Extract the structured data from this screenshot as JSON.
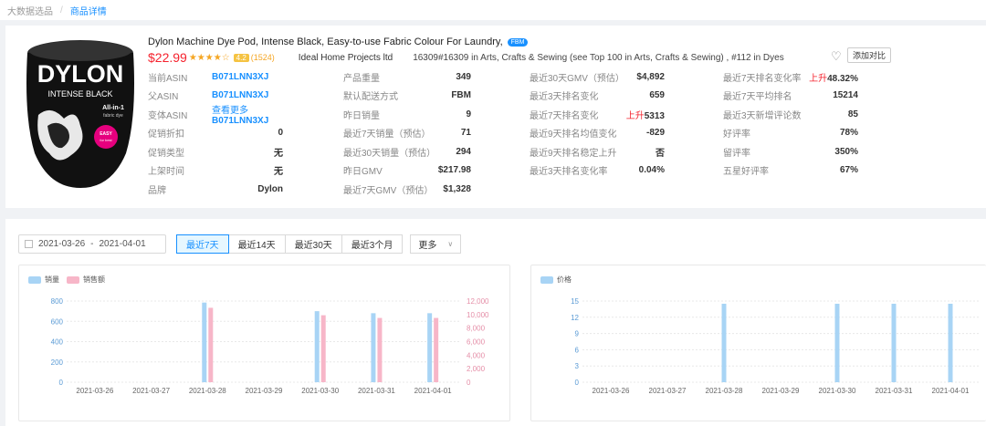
{
  "breadcrumb": {
    "root": "大数据选品",
    "separator": "/",
    "current": "商品详情"
  },
  "product": {
    "title": "Dylon Machine Dye Pod, Intense Black, Easy-to-use Fabric Colour For Laundry,",
    "badge": "FBM",
    "price": "$22.99",
    "stars": "★★★★☆",
    "rating": "4.2",
    "reviews": "(1524)",
    "seller": "Ideal Home Projects ltd",
    "rank_text": "16309#16309 in Arts, Crafts & Sewing (see Top 100 in Arts, Crafts & Sewing) , #112 in Dyes",
    "add_compare": "添加对比",
    "image": {
      "brand": "DYLON",
      "line1": "INTENSE BLACK",
      "line2": "All-in-1",
      "line3": "fabric dye",
      "badge1": "EASY",
      "badge2": "for best"
    },
    "colors": {
      "accent": "#1890ff",
      "red": "#f5222d",
      "star": "#f5a623"
    }
  },
  "info": {
    "col1": [
      {
        "label": "当前ASIN",
        "value": "B071LNN3XJ"
      },
      {
        "label": "父ASIN",
        "value": "B071LNN3XJ"
      },
      {
        "label": "变体ASIN",
        "link": "查看更多",
        "value": "B071LNN3XJ"
      },
      {
        "label": "促销折扣",
        "value": "0"
      },
      {
        "label": "促销类型",
        "value": "无"
      },
      {
        "label": "上架时间",
        "value": "无"
      },
      {
        "label": "品牌",
        "value": "Dylon"
      }
    ],
    "col2": [
      {
        "label": "产品重量",
        "value": "349"
      },
      {
        "label": "默认配送方式",
        "value": "FBM"
      },
      {
        "label": "昨日销量",
        "value": "9"
      },
      {
        "label": "最近7天销量（预估）",
        "value": "71"
      },
      {
        "label": "最近30天销量（预估）",
        "value": "294"
      },
      {
        "label": "昨日GMV",
        "value": "$217.98"
      },
      {
        "label": "最近7天GMV（预估）",
        "value": "$1,328"
      }
    ],
    "col3": [
      {
        "label": "最近30天GMV（预估）",
        "value": "$4,892"
      },
      {
        "label": "最近3天排名变化",
        "value": "659"
      },
      {
        "label": "最近7天排名变化",
        "prefix": "上升",
        "value": "5313"
      },
      {
        "label": "最近9天排名均值变化",
        "value": "-829"
      },
      {
        "label": "最近9天排名稳定上升",
        "value": "否"
      },
      {
        "label": "最近3天排名变化率",
        "value": "0.04%"
      }
    ],
    "col4": [
      {
        "label": "最近7天排名变化率",
        "prefix": "上升",
        "value": "48.32%"
      },
      {
        "label": "最近7天平均排名",
        "value": "15214"
      },
      {
        "label": "最近3天新增评论数",
        "value": "85"
      },
      {
        "label": "好评率",
        "value": "78%"
      },
      {
        "label": "留评率",
        "value": "350%"
      },
      {
        "label": "五星好评率",
        "value": "67%"
      }
    ]
  },
  "filters": {
    "date_start": "2021-03-26",
    "date_sep": "-",
    "date_end": "2021-04-01",
    "tabs": [
      "最近7天",
      "最近14天",
      "最近30天",
      "最近3个月"
    ],
    "active_tab": 0,
    "more": "更多"
  },
  "chart_data": [
    {
      "type": "bar",
      "legend": [
        "销量",
        "销售额"
      ],
      "categories": [
        "2021-03-26",
        "2021-03-27",
        "2021-03-28",
        "2021-03-29",
        "2021-03-30",
        "2021-03-31",
        "2021-04-01"
      ],
      "series": [
        {
          "name": "销量",
          "axis": "left",
          "color": "#a8d4f5",
          "values": [
            0,
            0,
            785,
            0,
            700,
            680,
            680
          ]
        },
        {
          "name": "销售额",
          "axis": "right",
          "color": "#f7b6c8",
          "values": [
            0,
            0,
            11000,
            0,
            9900,
            9500,
            9500
          ]
        }
      ],
      "y_left": {
        "ticks": [
          0,
          200,
          400,
          600,
          800
        ],
        "lim": [
          0,
          800
        ]
      },
      "y_right": {
        "ticks": [
          "0",
          "2,000",
          "4,000",
          "6,000",
          "8,000",
          "10,000",
          "12,000"
        ],
        "lim": [
          0,
          12000
        ]
      }
    },
    {
      "type": "bar",
      "legend": [
        "价格"
      ],
      "categories": [
        "2021-03-26",
        "2021-03-27",
        "2021-03-28",
        "2021-03-29",
        "2021-03-30",
        "2021-03-31",
        "2021-04-01"
      ],
      "series": [
        {
          "name": "价格",
          "color": "#a8d4f5",
          "values": [
            0,
            0,
            14.5,
            0,
            14.5,
            14.5,
            14.5
          ]
        }
      ],
      "y_left": {
        "ticks": [
          0,
          3,
          6,
          9,
          12,
          15
        ],
        "lim": [
          0,
          15
        ]
      }
    }
  ]
}
